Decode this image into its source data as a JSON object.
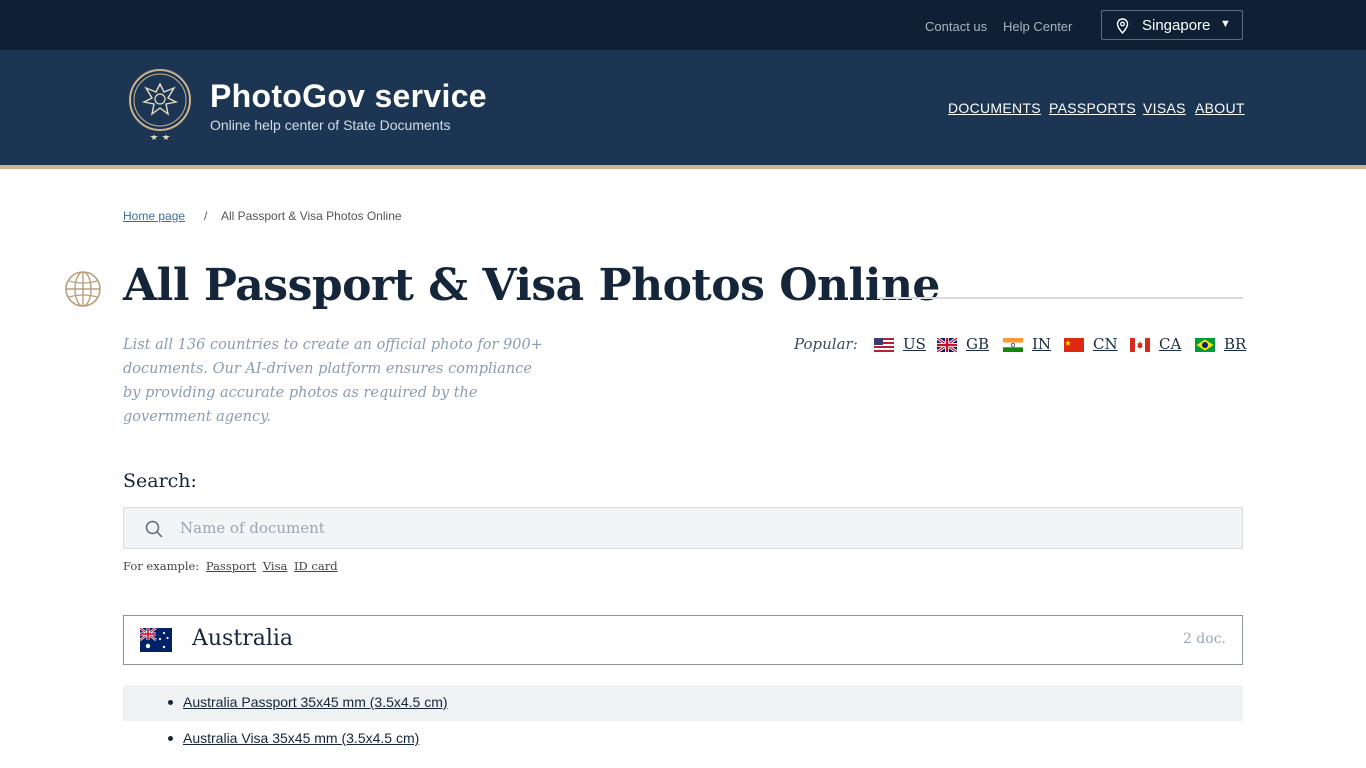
{
  "topbar": {
    "contact": "Contact us",
    "help": "Help Center",
    "region": "Singapore"
  },
  "header": {
    "brand": "PhotoGov service",
    "tagline": "Online help center of State Documents",
    "nav": [
      "DOCUMENTS",
      "PASSPORTS",
      "VISAS",
      "ABOUT"
    ]
  },
  "breadcrumb": {
    "home": "Home page",
    "separator": "/",
    "current": "All Passport & Visa Photos Online"
  },
  "page": {
    "title": "All Passport & Visa Photos Online",
    "intro": "List all 136 countries to create an official photo for 900+ documents. Our AI-driven platform ensures compliance by providing accurate photos as required by the government agency."
  },
  "popular": {
    "label": "Popular:",
    "items": [
      "US",
      "GB",
      "IN",
      "CN",
      "CA",
      "BR"
    ]
  },
  "search": {
    "label": "Search:",
    "placeholder": "Name of document",
    "value": "",
    "example_label": "For example:",
    "examples": [
      "Passport",
      "Visa",
      "ID card"
    ]
  },
  "countries": [
    {
      "name": "Australia",
      "count": "2 doc.",
      "documents": [
        "Australia Passport 35x45 mm (3.5x4.5 cm)",
        "Australia Visa 35x45 mm (3.5x4.5 cm)"
      ]
    }
  ],
  "colors": {
    "topbar": "#0f2035",
    "header": "#1b3553",
    "accent_line": "#cdb38e",
    "title": "#15253a",
    "muted": "#8a9cb2"
  }
}
